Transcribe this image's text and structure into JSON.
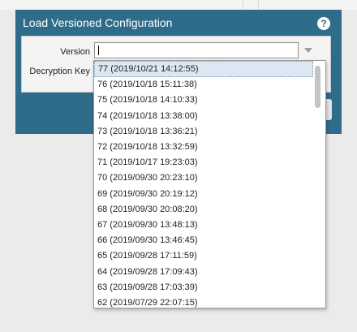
{
  "dialog": {
    "title": "Load Versioned Configuration",
    "help_icon": "help-icon",
    "version_label": "Version",
    "decryption_key_label": "Decryption Key",
    "version_value": ""
  },
  "version_options": [
    "77 (2019/10/21 14:12:55)",
    "76 (2019/10/18 15:11:38)",
    "75 (2019/10/18 14:10:33)",
    "74 (2019/10/18 13:38:00)",
    "73 (2019/10/18 13:36:21)",
    "72 (2019/10/18 13:32:59)",
    "71 (2019/10/17 19:23:03)",
    "70 (2019/09/30 20:23:10)",
    "69 (2019/09/30 20:19:12)",
    "68 (2019/09/30 20:08:20)",
    "67 (2019/09/30 13:48:13)",
    "66 (2019/09/30 13:46:45)",
    "65 (2019/09/28 17:11:59)",
    "64 (2019/09/28 17:09:43)",
    "63 (2019/09/28 17:03:39)",
    "62 (2019/07/29 22:07:15)"
  ],
  "highlighted_option_index": 0,
  "colors": {
    "header": "#2f6c8a",
    "highlight": "#dbe8f3"
  }
}
